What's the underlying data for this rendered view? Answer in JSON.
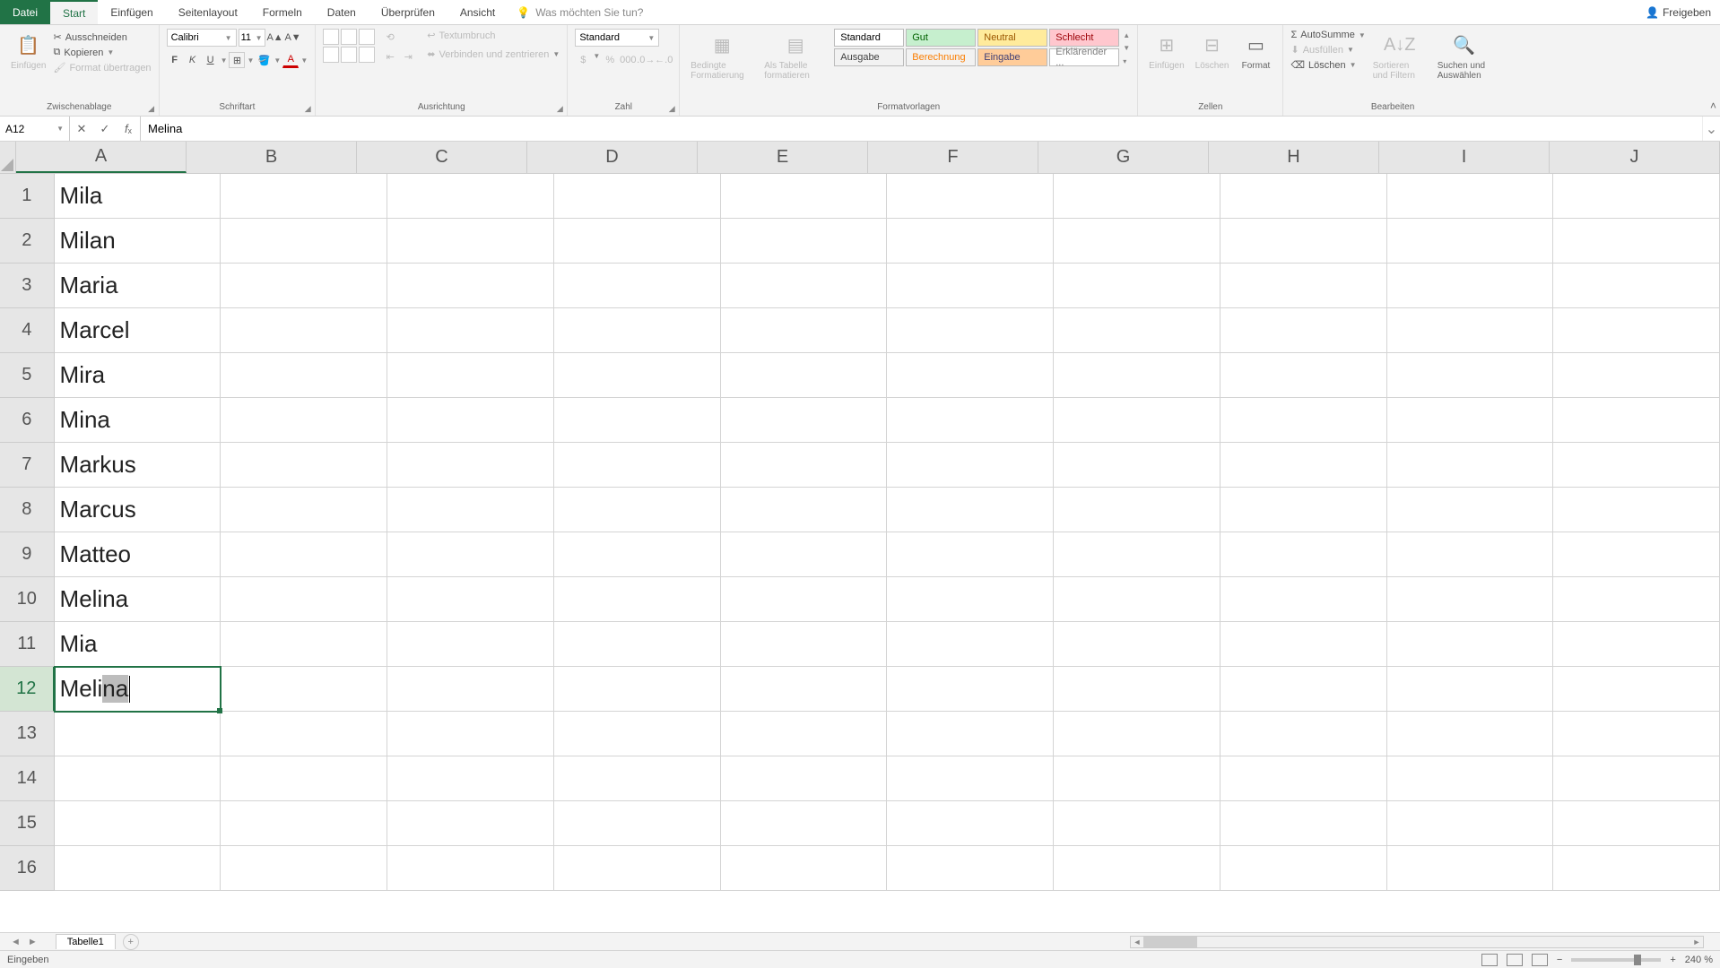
{
  "tabs": {
    "file": "Datei",
    "start": "Start",
    "insert": "Einfügen",
    "pagelayout": "Seitenlayout",
    "formulas": "Formeln",
    "data": "Daten",
    "review": "Überprüfen",
    "view": "Ansicht"
  },
  "search_placeholder": "Was möchten Sie tun?",
  "share": "Freigeben",
  "ribbon": {
    "clipboard": {
      "paste": "Einfügen",
      "cut": "Ausschneiden",
      "copy": "Kopieren",
      "format_painter": "Format übertragen",
      "label": "Zwischenablage"
    },
    "font": {
      "name": "Calibri",
      "size": "11",
      "label": "Schriftart"
    },
    "alignment": {
      "wrap": "Textumbruch",
      "merge": "Verbinden und zentrieren",
      "label": "Ausrichtung"
    },
    "number": {
      "format": "Standard",
      "label": "Zahl"
    },
    "styles": {
      "conditional": "Bedingte Formatierung",
      "as_table": "Als Tabelle formatieren",
      "cell_styles_row1": [
        "Standard",
        "Gut",
        "Neutral",
        "Schlecht"
      ],
      "cell_styles_row2": [
        "Ausgabe",
        "Berechnung",
        "Eingabe",
        "Erklärender ..."
      ],
      "label": "Formatvorlagen"
    },
    "cells": {
      "insert": "Einfügen",
      "delete": "Löschen",
      "format": "Format",
      "label": "Zellen"
    },
    "editing": {
      "autosum": "AutoSumme",
      "fill": "Ausfüllen",
      "clear": "Löschen",
      "sort": "Sortieren und Filtern",
      "find": "Suchen und Auswählen",
      "label": "Bearbeiten"
    }
  },
  "name_box": "A12",
  "formula_value": "Melina",
  "columns": [
    "A",
    "B",
    "C",
    "D",
    "E",
    "F",
    "G",
    "H",
    "I",
    "J"
  ],
  "row_numbers": [
    "1",
    "2",
    "3",
    "4",
    "5",
    "6",
    "7",
    "8",
    "9",
    "10",
    "11",
    "12",
    "13",
    "14",
    "15",
    "16"
  ],
  "cell_values": {
    "A1": "Mila",
    "A2": "Milan",
    "A3": "Maria",
    "A4": "Marcel",
    "A5": "Mira",
    "A6": "Mina",
    "A7": "Markus",
    "A8": "Marcus",
    "A9": "Matteo",
    "A10": "Melina",
    "A11": "Mia"
  },
  "editing_cell": {
    "typed": "Meli",
    "autocomplete": "na"
  },
  "sheet_tab": "Tabelle1",
  "status_mode": "Eingeben",
  "zoom": "240 %",
  "style_colors": {
    "Standard": {
      "bg": "#ffffff",
      "fg": "#000000"
    },
    "Gut": {
      "bg": "#c6efce",
      "fg": "#006100"
    },
    "Neutral": {
      "bg": "#ffeb9c",
      "fg": "#9c5700"
    },
    "Schlecht": {
      "bg": "#ffc7ce",
      "fg": "#9c0006"
    },
    "Ausgabe": {
      "bg": "#f2f2f2",
      "fg": "#3f3f3f"
    },
    "Berechnung": {
      "bg": "#f2f2f2",
      "fg": "#fa7d00"
    },
    "Eingabe": {
      "bg": "#ffcc99",
      "fg": "#3f3f76"
    },
    "Erklärender ...": {
      "bg": "#ffffff",
      "fg": "#7f7f7f"
    }
  }
}
